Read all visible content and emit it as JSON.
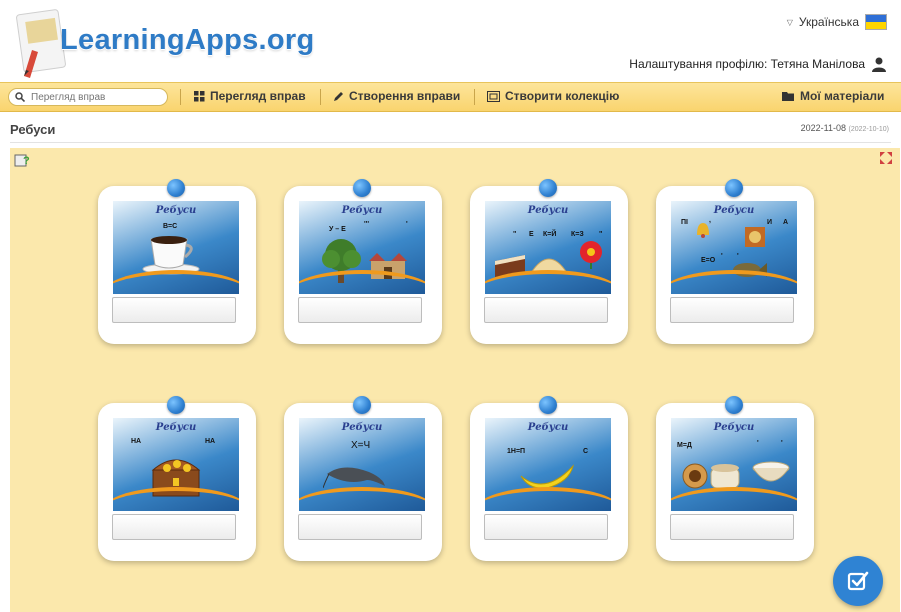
{
  "header": {
    "site_name": "LearningApps.org",
    "language": "Українська",
    "profile_label": "Налаштування профілю: Тетяна Манілова"
  },
  "nav": {
    "search_placeholder": "Перегляд вправ",
    "browse_apps": "Перегляд вправ",
    "create_app": "Створення вправи",
    "create_collection": "Створити колекцію",
    "my_materials": "Мої матеріали"
  },
  "page": {
    "title": "Ребуси",
    "date": "2022-11-08",
    "date_sub": "(2022-10-10)"
  },
  "cards": [
    {
      "title": "Ребуси",
      "clues": [
        "В=С"
      ],
      "picture": "coffee-cup",
      "answer": ""
    },
    {
      "title": "Ребуси",
      "clues": [
        "У – Е",
        "'''",
        "'"
      ],
      "picture": "tree-and-castle",
      "answer": ""
    },
    {
      "title": "Ребуси",
      "clues": [
        "\"",
        "Е",
        "К=Й",
        "К=З",
        "\""
      ],
      "picture": "cake-dumpling-flower",
      "answer": ""
    },
    {
      "title": "Ребуси",
      "clues": [
        "ПІ",
        ",",
        "И",
        "А",
        "Е=О",
        "'",
        "'"
      ],
      "picture": "bells-icon-fish",
      "answer": ""
    },
    {
      "title": "Ребуси",
      "clues": [
        "НА",
        "НА"
      ],
      "picture": "treasure-chest",
      "answer": ""
    },
    {
      "title": "Ребуси",
      "clues": [
        "Х=Ч"
      ],
      "picture": "catfish",
      "answer": ""
    },
    {
      "title": "Ребуси",
      "clues": [
        "1Н=П",
        "С"
      ],
      "picture": "banana",
      "answer": ""
    },
    {
      "title": "Ребуси",
      "clues": [
        "М=Д",
        "'",
        "'"
      ],
      "picture": "jars",
      "answer": ""
    }
  ],
  "colors": {
    "stage_bg": "#fbe8ac",
    "navbar": "#f9d46e",
    "accent_blue": "#2f83d3",
    "logo_blue": "#2e7bc6"
  }
}
